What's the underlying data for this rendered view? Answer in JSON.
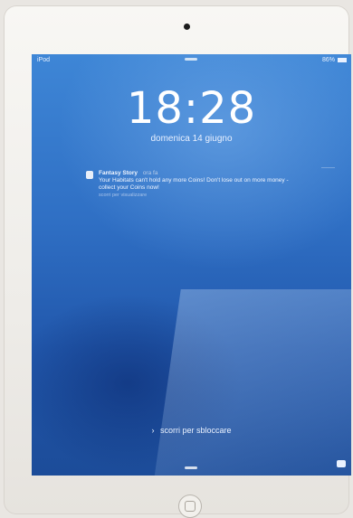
{
  "status_bar": {
    "carrier": "iPod",
    "battery": "86%"
  },
  "lock_screen": {
    "time": "18:28",
    "date": "domenica 14 giugno",
    "unlock_hint": "scorri per sbloccare"
  },
  "notification": {
    "app_name": "Fantasy Story",
    "time_ago": "ora fa",
    "message": "Your Habitats can't hold any more Coins! Don't lose out on more money - collect your Coins now!",
    "action": "scorri per visualizzare"
  },
  "icons": [
    "wifi-icon",
    "battery-icon",
    "app-icon",
    "chevron-right-icon",
    "camera-icon",
    "home-button-icon"
  ],
  "colors": {
    "wallpaper_top": "#3e86d6",
    "wallpaper_bottom": "#1c4c99",
    "device_bezel": "#f8f7f4"
  }
}
